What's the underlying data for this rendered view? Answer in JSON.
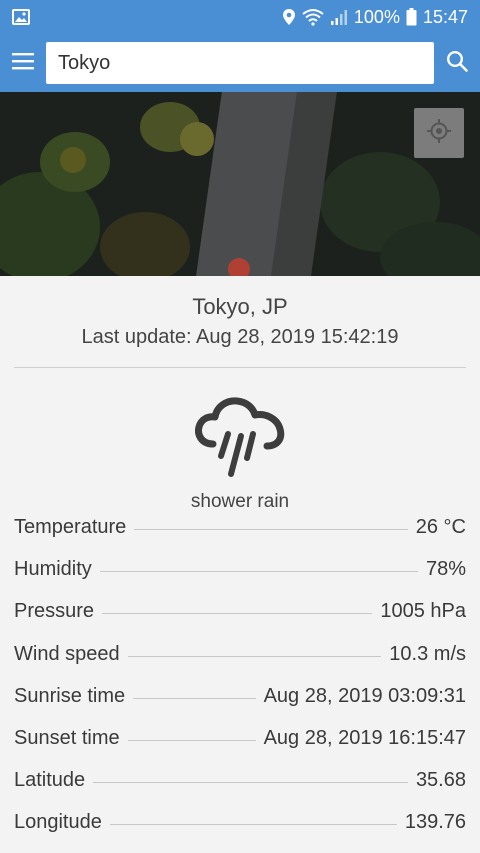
{
  "status_bar": {
    "battery": "100%",
    "time": "15:47",
    "icons": [
      "image-icon",
      "location-pin-icon",
      "wifi-icon",
      "signal-icon",
      "battery-icon"
    ]
  },
  "search": {
    "value": "Tokyo"
  },
  "location": {
    "city": "Tokyo, JP",
    "last_update": "Last update: Aug 28, 2019 15:42:19"
  },
  "weather": {
    "icon": "shower-rain-icon",
    "description": "shower rain"
  },
  "details": [
    {
      "label": "Temperature",
      "value": "26 °C"
    },
    {
      "label": "Humidity",
      "value": "78%"
    },
    {
      "label": "Pressure",
      "value": "1005 hPa"
    },
    {
      "label": "Wind speed",
      "value": "10.3 m/s"
    },
    {
      "label": "Sunrise time",
      "value": "Aug 28, 2019 03:09:31"
    },
    {
      "label": "Sunset time",
      "value": "Aug 28, 2019 16:15:47"
    },
    {
      "label": "Latitude",
      "value": "35.68"
    },
    {
      "label": "Longitude",
      "value": "139.76"
    }
  ],
  "colors": {
    "app_bar": "#4a8fd3",
    "background": "#f3f3f3"
  }
}
